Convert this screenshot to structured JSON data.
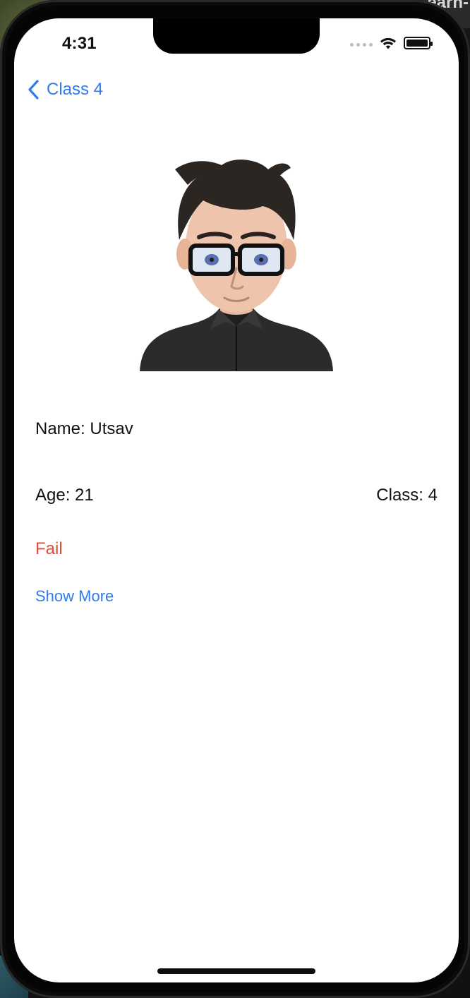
{
  "status_bar": {
    "time": "4:31"
  },
  "nav": {
    "back_label": "Class 4"
  },
  "profile": {
    "name_line": "Name: Utsav",
    "age_line": "Age: 21",
    "class_line": "Class: 4",
    "status": "Fail",
    "show_more": "Show More"
  },
  "background": {
    "corner_text": "earn-"
  },
  "colors": {
    "accent": "#2f7bf0",
    "status_fail": "#e24b3b",
    "text": "#111111"
  },
  "icons": {
    "back": "chevron-left-icon",
    "wifi": "wifi-icon",
    "battery": "battery-icon",
    "signal": "signal-dots-icon"
  }
}
